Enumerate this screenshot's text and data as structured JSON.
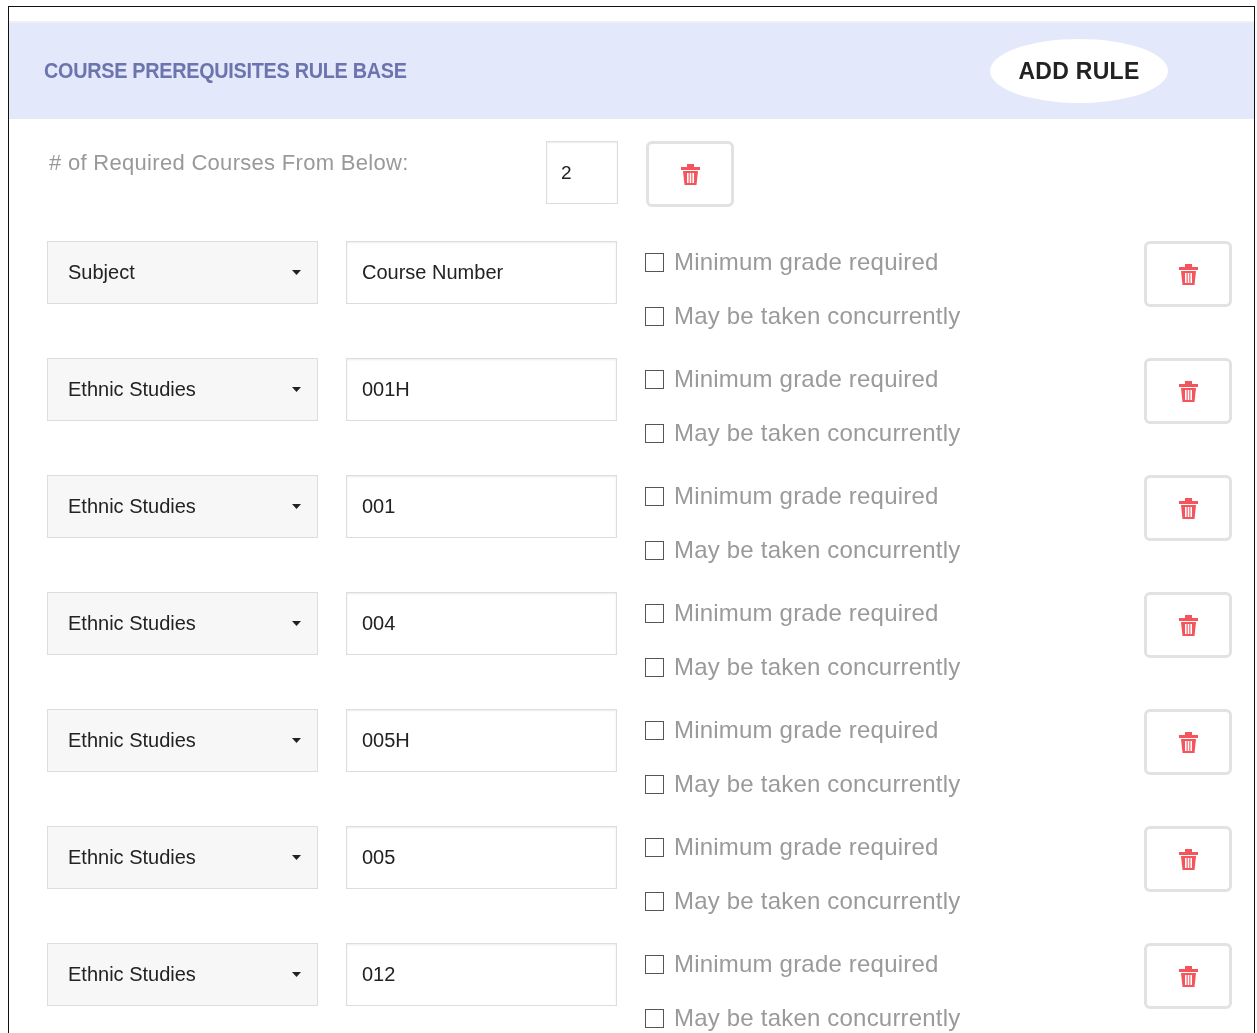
{
  "header": {
    "title": "COURSE PREREQUISITES RULE BASE",
    "add_button": "ADD RULE"
  },
  "required": {
    "label": "# of Required Courses From Below:",
    "value": "2"
  },
  "rows": [
    {
      "subject": "Subject",
      "placeholder": "Course Number",
      "options": [
        {
          "label": "Minimum grade required",
          "checked": false
        },
        {
          "label": "May be taken concurrently",
          "checked": false
        }
      ]
    },
    {
      "subject": "Ethnic Studies",
      "number": "001H",
      "options": [
        {
          "label": "Minimum grade required",
          "checked": false
        },
        {
          "label": "May be taken concurrently",
          "checked": false
        }
      ]
    },
    {
      "subject": "Ethnic Studies",
      "number": "001",
      "options": [
        {
          "label": "Minimum grade required",
          "checked": false
        },
        {
          "label": "May be taken concurrently",
          "checked": false
        }
      ]
    },
    {
      "subject": "Ethnic Studies",
      "number": "004",
      "options": [
        {
          "label": "Minimum grade required",
          "checked": false
        },
        {
          "label": "May be taken concurrently",
          "checked": false
        }
      ]
    },
    {
      "subject": "Ethnic Studies",
      "number": "005H",
      "options": [
        {
          "label": "Minimum grade required",
          "checked": false
        },
        {
          "label": "May be taken concurrently",
          "checked": false
        }
      ]
    },
    {
      "subject": "Ethnic Studies",
      "number": "005",
      "options": [
        {
          "label": "Minimum grade required",
          "checked": false
        },
        {
          "label": "May be taken concurrently",
          "checked": false
        }
      ]
    },
    {
      "subject": "Ethnic Studies",
      "number": "012",
      "options": [
        {
          "label": "Minimum grade required",
          "checked": false
        },
        {
          "label": "May be taken concurrently",
          "checked": false
        }
      ]
    }
  ]
}
